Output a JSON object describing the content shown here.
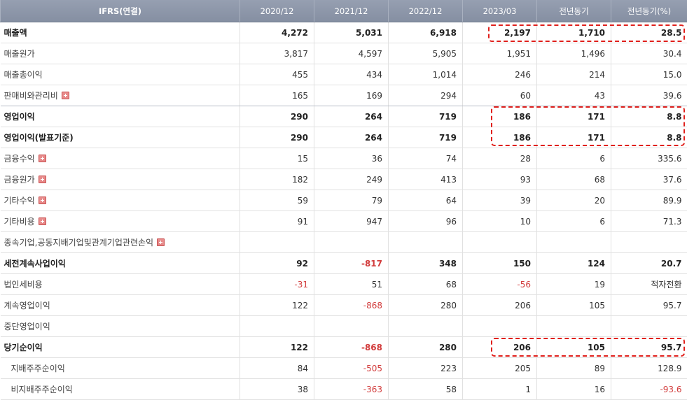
{
  "table": {
    "headers": [
      "IFRS(연결)",
      "2020/12",
      "2021/12",
      "2022/12",
      "2023/03",
      "전년동기",
      "전년동기(%)"
    ],
    "rows": [
      {
        "label": "매출액",
        "values": [
          "4,272",
          "5,031",
          "6,918",
          "2,197",
          "1,710",
          "28.5"
        ]
      },
      {
        "label": "매출원가",
        "values": [
          "3,817",
          "4,597",
          "5,905",
          "1,951",
          "1,496",
          "30.4"
        ]
      },
      {
        "label": "매출총이익",
        "values": [
          "455",
          "434",
          "1,014",
          "246",
          "214",
          "15.0"
        ]
      },
      {
        "label": "판매비와관리비",
        "values": [
          "165",
          "169",
          "294",
          "60",
          "43",
          "39.6"
        ]
      },
      {
        "label": "영업이익",
        "values": [
          "290",
          "264",
          "719",
          "186",
          "171",
          "8.8"
        ]
      },
      {
        "label": "영업이익(발표기준)",
        "values": [
          "290",
          "264",
          "719",
          "186",
          "171",
          "8.8"
        ]
      },
      {
        "label": "금융수익",
        "values": [
          "15",
          "36",
          "74",
          "28",
          "6",
          "335.6"
        ]
      },
      {
        "label": "금융원가",
        "values": [
          "182",
          "249",
          "413",
          "93",
          "68",
          "37.6"
        ]
      },
      {
        "label": "기타수익",
        "values": [
          "59",
          "79",
          "64",
          "39",
          "20",
          "89.9"
        ]
      },
      {
        "label": "기타비용",
        "values": [
          "91",
          "947",
          "96",
          "10",
          "6",
          "71.3"
        ]
      },
      {
        "label": "종속기업,공동지배기업및관계기업관련손익",
        "values": [
          "",
          "",
          "",
          "",
          "",
          ""
        ]
      },
      {
        "label": "세전계속사업이익",
        "values": [
          "92",
          "-817",
          "348",
          "150",
          "124",
          "20.7"
        ]
      },
      {
        "label": "법인세비용",
        "values": [
          "-31",
          "51",
          "68",
          "-56",
          "19",
          "적자전환"
        ]
      },
      {
        "label": "계속영업이익",
        "values": [
          "122",
          "-868",
          "280",
          "206",
          "105",
          "95.7"
        ]
      },
      {
        "label": "중단영업이익",
        "values": [
          "",
          "",
          "",
          "",
          "",
          ""
        ]
      },
      {
        "label": "당기순이익",
        "values": [
          "122",
          "-868",
          "280",
          "206",
          "105",
          "95.7"
        ]
      },
      {
        "label": "지배주주순이익",
        "values": [
          "84",
          "-505",
          "223",
          "205",
          "89",
          "128.9"
        ]
      },
      {
        "label": "비지배주주순이익",
        "values": [
          "38",
          "-363",
          "58",
          "1",
          "16",
          "-93.6"
        ]
      }
    ]
  },
  "colors": {
    "header_bg": "#8b95a8",
    "negative_text": "#d23c3c",
    "highlight_border": "#e0201c",
    "expand_icon": "#e88c8c"
  }
}
